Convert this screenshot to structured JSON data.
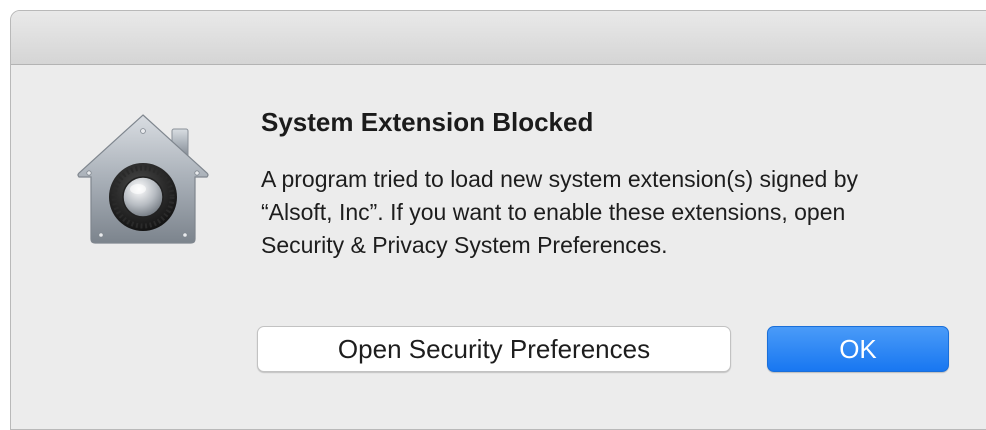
{
  "dialog": {
    "title": "System Extension Blocked",
    "message": "A program tried to load new system extension(s) signed by “Alsoft, Inc”.  If you want to enable these extensions, open Security & Privacy System Preferences.",
    "icon": "security-house-lock-icon",
    "buttons": {
      "open_security_label": "Open Security Preferences",
      "ok_label": "OK"
    }
  },
  "colors": {
    "dialog_background": "#ececec",
    "primary_button": "#1877f1",
    "secondary_button": "#ffffff"
  }
}
